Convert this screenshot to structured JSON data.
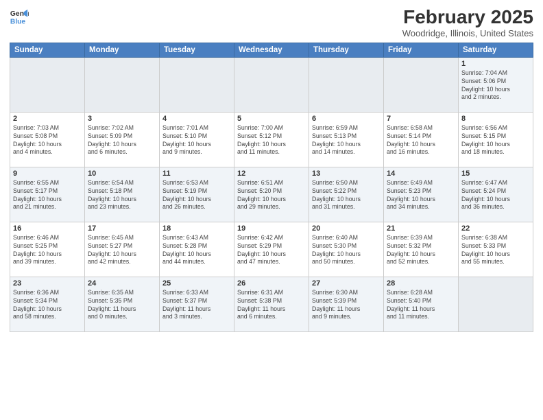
{
  "header": {
    "logo_line1": "General",
    "logo_line2": "Blue",
    "month_year": "February 2025",
    "location": "Woodridge, Illinois, United States"
  },
  "weekdays": [
    "Sunday",
    "Monday",
    "Tuesday",
    "Wednesday",
    "Thursday",
    "Friday",
    "Saturday"
  ],
  "weeks": [
    [
      {
        "day": "",
        "info": ""
      },
      {
        "day": "",
        "info": ""
      },
      {
        "day": "",
        "info": ""
      },
      {
        "day": "",
        "info": ""
      },
      {
        "day": "",
        "info": ""
      },
      {
        "day": "",
        "info": ""
      },
      {
        "day": "1",
        "info": "Sunrise: 7:04 AM\nSunset: 5:06 PM\nDaylight: 10 hours\nand 2 minutes."
      }
    ],
    [
      {
        "day": "2",
        "info": "Sunrise: 7:03 AM\nSunset: 5:08 PM\nDaylight: 10 hours\nand 4 minutes."
      },
      {
        "day": "3",
        "info": "Sunrise: 7:02 AM\nSunset: 5:09 PM\nDaylight: 10 hours\nand 6 minutes."
      },
      {
        "day": "4",
        "info": "Sunrise: 7:01 AM\nSunset: 5:10 PM\nDaylight: 10 hours\nand 9 minutes."
      },
      {
        "day": "5",
        "info": "Sunrise: 7:00 AM\nSunset: 5:12 PM\nDaylight: 10 hours\nand 11 minutes."
      },
      {
        "day": "6",
        "info": "Sunrise: 6:59 AM\nSunset: 5:13 PM\nDaylight: 10 hours\nand 14 minutes."
      },
      {
        "day": "7",
        "info": "Sunrise: 6:58 AM\nSunset: 5:14 PM\nDaylight: 10 hours\nand 16 minutes."
      },
      {
        "day": "8",
        "info": "Sunrise: 6:56 AM\nSunset: 5:15 PM\nDaylight: 10 hours\nand 18 minutes."
      }
    ],
    [
      {
        "day": "9",
        "info": "Sunrise: 6:55 AM\nSunset: 5:17 PM\nDaylight: 10 hours\nand 21 minutes."
      },
      {
        "day": "10",
        "info": "Sunrise: 6:54 AM\nSunset: 5:18 PM\nDaylight: 10 hours\nand 23 minutes."
      },
      {
        "day": "11",
        "info": "Sunrise: 6:53 AM\nSunset: 5:19 PM\nDaylight: 10 hours\nand 26 minutes."
      },
      {
        "day": "12",
        "info": "Sunrise: 6:51 AM\nSunset: 5:20 PM\nDaylight: 10 hours\nand 29 minutes."
      },
      {
        "day": "13",
        "info": "Sunrise: 6:50 AM\nSunset: 5:22 PM\nDaylight: 10 hours\nand 31 minutes."
      },
      {
        "day": "14",
        "info": "Sunrise: 6:49 AM\nSunset: 5:23 PM\nDaylight: 10 hours\nand 34 minutes."
      },
      {
        "day": "15",
        "info": "Sunrise: 6:47 AM\nSunset: 5:24 PM\nDaylight: 10 hours\nand 36 minutes."
      }
    ],
    [
      {
        "day": "16",
        "info": "Sunrise: 6:46 AM\nSunset: 5:25 PM\nDaylight: 10 hours\nand 39 minutes."
      },
      {
        "day": "17",
        "info": "Sunrise: 6:45 AM\nSunset: 5:27 PM\nDaylight: 10 hours\nand 42 minutes."
      },
      {
        "day": "18",
        "info": "Sunrise: 6:43 AM\nSunset: 5:28 PM\nDaylight: 10 hours\nand 44 minutes."
      },
      {
        "day": "19",
        "info": "Sunrise: 6:42 AM\nSunset: 5:29 PM\nDaylight: 10 hours\nand 47 minutes."
      },
      {
        "day": "20",
        "info": "Sunrise: 6:40 AM\nSunset: 5:30 PM\nDaylight: 10 hours\nand 50 minutes."
      },
      {
        "day": "21",
        "info": "Sunrise: 6:39 AM\nSunset: 5:32 PM\nDaylight: 10 hours\nand 52 minutes."
      },
      {
        "day": "22",
        "info": "Sunrise: 6:38 AM\nSunset: 5:33 PM\nDaylight: 10 hours\nand 55 minutes."
      }
    ],
    [
      {
        "day": "23",
        "info": "Sunrise: 6:36 AM\nSunset: 5:34 PM\nDaylight: 10 hours\nand 58 minutes."
      },
      {
        "day": "24",
        "info": "Sunrise: 6:35 AM\nSunset: 5:35 PM\nDaylight: 11 hours\nand 0 minutes."
      },
      {
        "day": "25",
        "info": "Sunrise: 6:33 AM\nSunset: 5:37 PM\nDaylight: 11 hours\nand 3 minutes."
      },
      {
        "day": "26",
        "info": "Sunrise: 6:31 AM\nSunset: 5:38 PM\nDaylight: 11 hours\nand 6 minutes."
      },
      {
        "day": "27",
        "info": "Sunrise: 6:30 AM\nSunset: 5:39 PM\nDaylight: 11 hours\nand 9 minutes."
      },
      {
        "day": "28",
        "info": "Sunrise: 6:28 AM\nSunset: 5:40 PM\nDaylight: 11 hours\nand 11 minutes."
      },
      {
        "day": "",
        "info": ""
      }
    ]
  ]
}
